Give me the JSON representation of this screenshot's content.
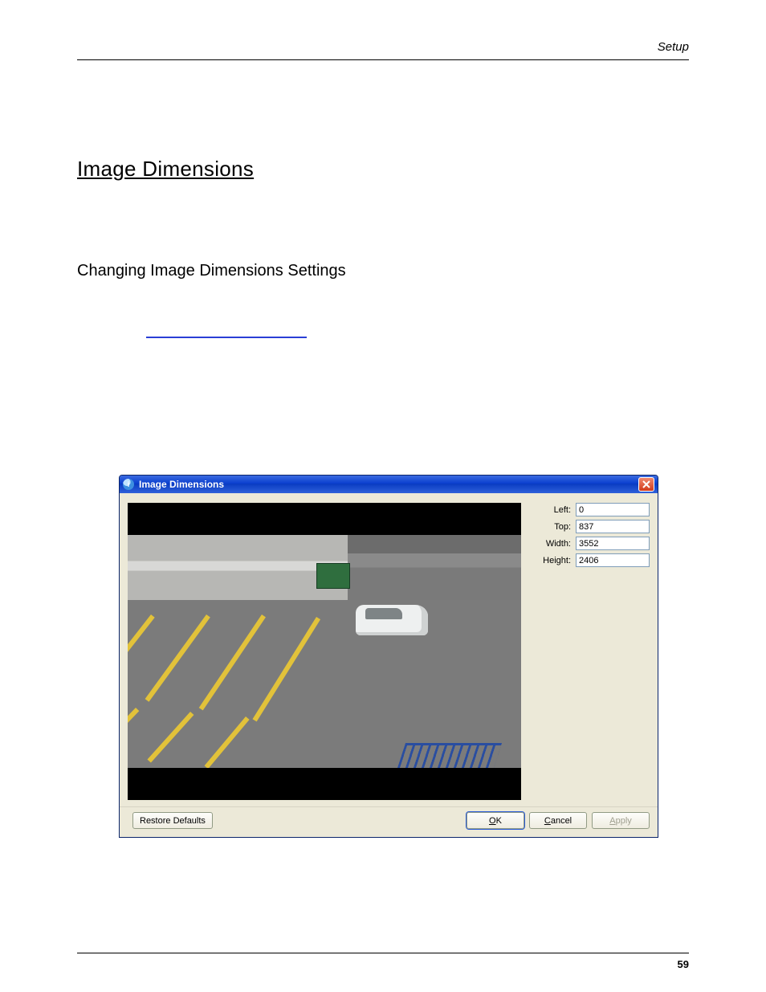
{
  "header": {
    "section": "Setup"
  },
  "headings": {
    "h1": "Image Dimensions",
    "h2": "Changing Image Dimensions Settings"
  },
  "dialog": {
    "title": "Image Dimensions",
    "fields": {
      "left": {
        "label": "Left:",
        "value": "0"
      },
      "top": {
        "label": "Top:",
        "value": "837"
      },
      "width": {
        "label": "Width:",
        "value": "3552"
      },
      "height": {
        "label": "Height:",
        "value": "2406"
      }
    },
    "buttons": {
      "restore": "Restore Defaults",
      "ok_pre": "",
      "ok_mn": "O",
      "ok_post": "K",
      "cancel_pre": "",
      "cancel_mn": "C",
      "cancel_post": "ancel",
      "apply_pre": "",
      "apply_mn": "A",
      "apply_post": "pply"
    }
  },
  "footer": {
    "page_number": "59"
  }
}
